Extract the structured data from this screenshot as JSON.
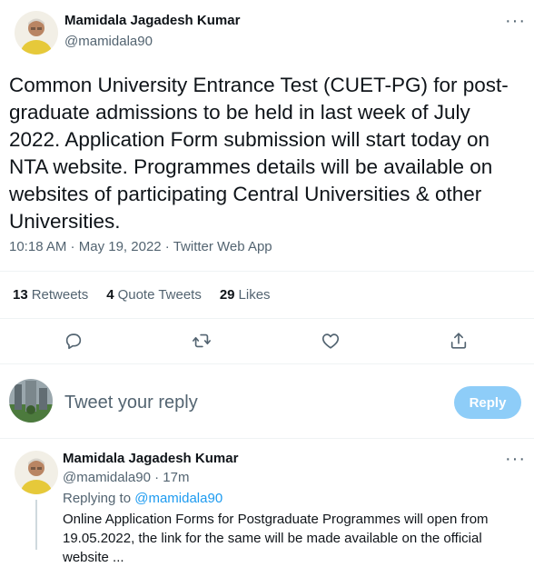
{
  "tweet": {
    "author_name": "Mamidala Jagadesh Kumar",
    "author_handle": "@mamidala90",
    "more_label": "···",
    "text": "Common University Entrance Test (CUET-PG) for post-graduate admissions to be held in last week of July 2022. Application Form submission will start today on NTA website.  Programmes details will be available on websites of participating Central Universities & other Universities.",
    "time": "10:18 AM",
    "date": "May 19, 2022",
    "source": "Twitter Web App",
    "separator": " · "
  },
  "stats": {
    "retweets_count": "13",
    "retweets_label": "Retweets",
    "quotes_count": "4",
    "quotes_label": "Quote Tweets",
    "likes_count": "29",
    "likes_label": "Likes"
  },
  "actions": [
    "reply-icon",
    "retweet-icon",
    "like-icon",
    "share-icon"
  ],
  "composer": {
    "placeholder": "Tweet your reply",
    "button_label": "Reply"
  },
  "reply": {
    "author_name": "Mamidala Jagadesh Kumar",
    "author_handle": "@mamidala90",
    "time_ago": "17m",
    "separator": " · ",
    "more_label": "···",
    "replying_to_prefix": "Replying to ",
    "replying_to_handle": "@mamidala90",
    "text_line1": "Online Application Forms for Postgraduate Programmes will open from",
    "text_line2": "19.05.2022, the link for the same will be made available on the official",
    "text_line3": "website ..."
  },
  "colors": {
    "accent": "#1d9bf0",
    "reply_button": "#8ecdf8",
    "secondary_text": "#536471"
  }
}
